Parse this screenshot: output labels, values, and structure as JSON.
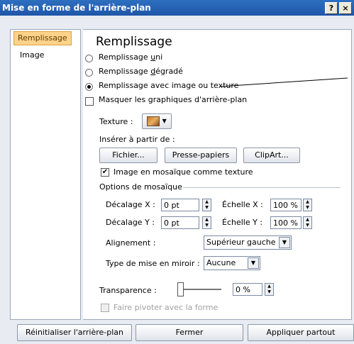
{
  "window": {
    "title": "Mise en forme de l'arrière-plan",
    "help": "?",
    "close": "×"
  },
  "sidebar": {
    "items": [
      {
        "label": "Remplissage"
      },
      {
        "label": "Image"
      }
    ]
  },
  "panel": {
    "heading": "Remplissage",
    "radios": [
      {
        "label": "Remplissage uni",
        "mnemonic_prefix": "Remplissage ",
        "mnemonic": "u",
        "suffix": "ni",
        "checked": false
      },
      {
        "label": "Remplissage dégradé",
        "mnemonic_prefix": "Remplissage ",
        "mnemonic": "d",
        "suffix": "égradé",
        "checked": false
      },
      {
        "label": "Remplissage avec image ou texture",
        "checked": true
      }
    ],
    "hide_graphics": {
      "label": "Masquer les graphiques d'arrière-plan",
      "checked": false
    },
    "texture_label": "Texture :",
    "insert_from": "Insérer à partir de :",
    "buttons": {
      "file": "Fichier...",
      "clipboard": "Presse-papiers",
      "clipart": "ClipArt..."
    },
    "tile": {
      "label": "Image en mosaïque comme texture",
      "checked": true
    },
    "tiling_options": "Options de mosaïque",
    "offset_x": {
      "label": "Décalage X :",
      "value": "0 pt"
    },
    "offset_y": {
      "label": "Décalage Y :",
      "value": "0 pt"
    },
    "scale_x": {
      "label": "Échelle X :",
      "value": "100 %"
    },
    "scale_y": {
      "label": "Échelle Y :",
      "value": "100 %"
    },
    "alignment": {
      "label": "Alignement :",
      "value": "Supérieur gauche"
    },
    "mirror": {
      "label": "Type de mise en miroir :",
      "value": "Aucune"
    },
    "transparency": {
      "label": "Transparence :",
      "value": "0 %",
      "level": 0
    },
    "rotate": {
      "label": "Faire pivoter avec la forme",
      "checked": false
    }
  },
  "footer": {
    "reset": "Réinitialiser l'arrière-plan",
    "close": "Fermer",
    "apply_all": "Appliquer partout"
  },
  "colors": {
    "titlebar": "#1f56a8",
    "selected_tab": "#ffd28a"
  }
}
